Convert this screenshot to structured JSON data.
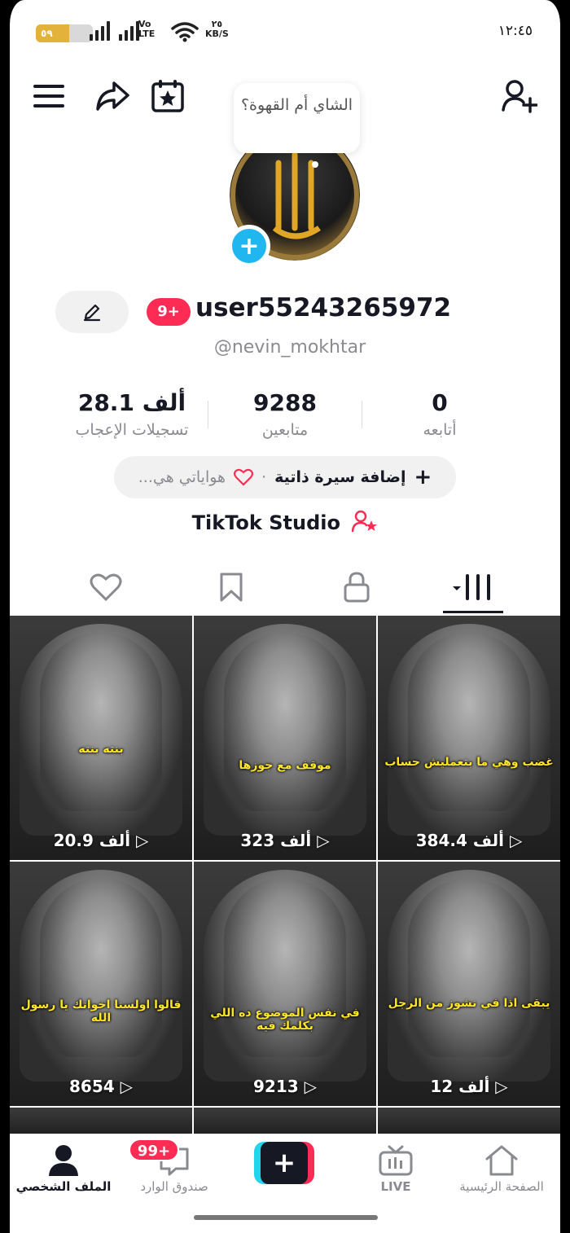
{
  "status_bar": {
    "battery": "٥٩",
    "battery_level": 0.59,
    "network": "Vo LTE",
    "speed_value": "٢٥",
    "speed_unit": "KB/S",
    "time": "١٢:٤٥"
  },
  "header": {
    "note_bubble": "الشاي أم القهوة؟"
  },
  "profile": {
    "badge": "9+",
    "username": "user55243265972",
    "handle": "@nevin_mokhtar"
  },
  "stats": [
    {
      "value": "28.1 ألف",
      "label": "تسجيلات الإعجاب"
    },
    {
      "value": "9288",
      "label": "متابعين"
    },
    {
      "value": "0",
      "label": "أتابعه"
    }
  ],
  "bio": {
    "add_label": "إضافة سيرة ذاتية",
    "separator": "·",
    "hobbies": "هواياتي هي..."
  },
  "studio_label": "TikTok Studio",
  "videos": [
    {
      "caption": "بنته بنته",
      "views": "20.9 ألف"
    },
    {
      "caption": "موقف مع جوزها",
      "views": "323 ألف"
    },
    {
      "caption": "غضب وهي ما بتعمليش حساب",
      "views": "384.4 ألف"
    },
    {
      "caption": "قالوا اولسنا اخوانك يا رسول الله",
      "views": "8654"
    },
    {
      "caption": "في نفس الموضوع ده اللي بكلمك فيه",
      "views": "9213"
    },
    {
      "caption": "يبقى اذا في نشوز من الرجل",
      "views": "12 ألف"
    }
  ],
  "bottom_nav": {
    "profile": "الملف الشخصي",
    "inbox": "صندوق الوارد",
    "inbox_badge": "99+",
    "create": "+",
    "live": "LIVE",
    "home": "الصفحة الرئيسية"
  },
  "colors": {
    "accent": "#fe2c55",
    "cyan": "#20d5ec",
    "caption": "#ffe52a"
  }
}
